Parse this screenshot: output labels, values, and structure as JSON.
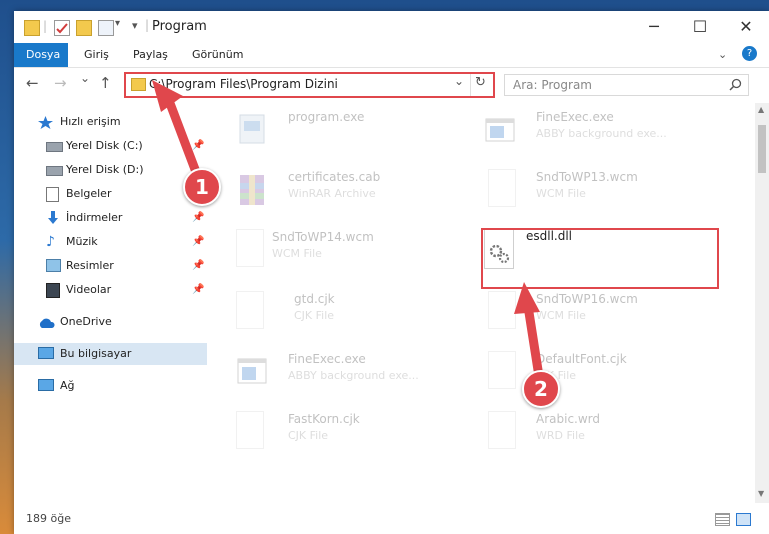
{
  "window": {
    "title": "Program",
    "controls": {
      "minimize": "─",
      "maximize": "☐",
      "close": "✕"
    }
  },
  "ribbon": {
    "tabs": [
      {
        "label": "Dosya",
        "active": true
      },
      {
        "label": "Giriş"
      },
      {
        "label": "Paylaş"
      },
      {
        "label": "Görünüm"
      }
    ],
    "collapse_icon": "chevron-down-icon",
    "help_icon": "?"
  },
  "nav": {
    "back": "←",
    "forward": "→",
    "recent": "⌄",
    "up": "↑",
    "address": "C:\\Program Files\\Program Dizini",
    "refresh": "↻",
    "dropdown": "⌄",
    "search_placeholder": "Ara: Program"
  },
  "sidebar": {
    "items": [
      {
        "label": "Hızlı erişim",
        "icon": "star-icon",
        "pinned": false
      },
      {
        "label": "Yerel Disk (C:)",
        "icon": "drive-icon",
        "pinned": true
      },
      {
        "label": "Yerel Disk (D:)",
        "icon": "drive-icon",
        "pinned": false
      },
      {
        "label": "Belgeler",
        "icon": "documents-icon",
        "pinned": false
      },
      {
        "label": "İndirmeler",
        "icon": "download-icon",
        "pinned": true
      },
      {
        "label": "Müzik",
        "icon": "music-icon",
        "pinned": true
      },
      {
        "label": "Resimler",
        "icon": "pictures-icon",
        "pinned": true
      },
      {
        "label": "Videolar",
        "icon": "videos-icon",
        "pinned": true
      },
      {
        "label": "OneDrive",
        "icon": "cloud-icon",
        "pinned": false
      },
      {
        "label": "Bu bilgisayar",
        "icon": "computer-icon",
        "pinned": false,
        "selected": true
      },
      {
        "label": "Ağ",
        "icon": "network-icon",
        "pinned": false
      }
    ]
  },
  "files": [
    {
      "name": "program.exe",
      "type": "",
      "icon": "setup-icon"
    },
    {
      "name": "FineExec.exe",
      "type": "ABBY background exe...",
      "icon": "app-window-icon"
    },
    {
      "name": "certificates.cab",
      "type": "WinRAR Archive",
      "icon": "archive-icon"
    },
    {
      "name": "SndToWP13.wcm",
      "type": "WCM File",
      "icon": "file-icon"
    },
    {
      "name": "SndToWP14.wcm",
      "type": "WCM File",
      "icon": "file-icon"
    },
    {
      "name": "esdll.dll",
      "type": "",
      "icon": "dll-gear-icon",
      "highlighted": true
    },
    {
      "name": "gtd.cjk",
      "type": "CJK File",
      "icon": "file-icon"
    },
    {
      "name": "SndToWP16.wcm",
      "type": "WCM File",
      "icon": "file-icon"
    },
    {
      "name": "FineExec.exe",
      "type": "ABBY background exe...",
      "icon": "app-window-icon"
    },
    {
      "name": "DefaultFont.cjk",
      "type": "CJK File",
      "icon": "file-icon"
    },
    {
      "name": "FastKorn.cjk",
      "type": "CJK File",
      "icon": "file-icon"
    },
    {
      "name": "Arabic.wrd",
      "type": "WRD File",
      "icon": "file-icon"
    }
  ],
  "status": {
    "count": "189 öğe"
  },
  "annotations": {
    "step1": "1",
    "step2": "2",
    "color": "#e0474c"
  }
}
